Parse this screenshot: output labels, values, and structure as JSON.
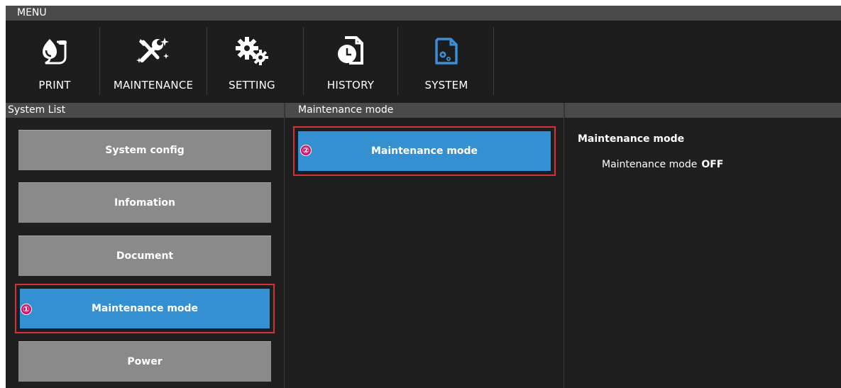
{
  "menu_label": "MENU",
  "toolbar": {
    "items": [
      {
        "label": "PRINT",
        "icon": "print-icon"
      },
      {
        "label": "MAINTENANCE",
        "icon": "maintenance-tools-icon"
      },
      {
        "label": "SETTING",
        "icon": "gears-icon"
      },
      {
        "label": "HISTORY",
        "icon": "history-clock-icon"
      },
      {
        "label": "SYSTEM",
        "icon": "system-doc-gears-icon",
        "active": true
      }
    ],
    "active_color": "#3a8fd8"
  },
  "system_list": {
    "header": "System List",
    "items": [
      {
        "label": "System config"
      },
      {
        "label": "Infomation"
      },
      {
        "label": "Document"
      },
      {
        "label": "Maintenance mode",
        "selected": true
      },
      {
        "label": "Power"
      }
    ]
  },
  "submenu": {
    "header": "Maintenance mode",
    "items": [
      {
        "label": "Maintenance mode",
        "selected": true
      }
    ]
  },
  "detail": {
    "title": "Maintenance mode",
    "row_label": "Maintenance mode",
    "row_value": "OFF"
  },
  "annotations": {
    "step1": "①",
    "step2": "②",
    "highlight_color": "#d6303b"
  }
}
